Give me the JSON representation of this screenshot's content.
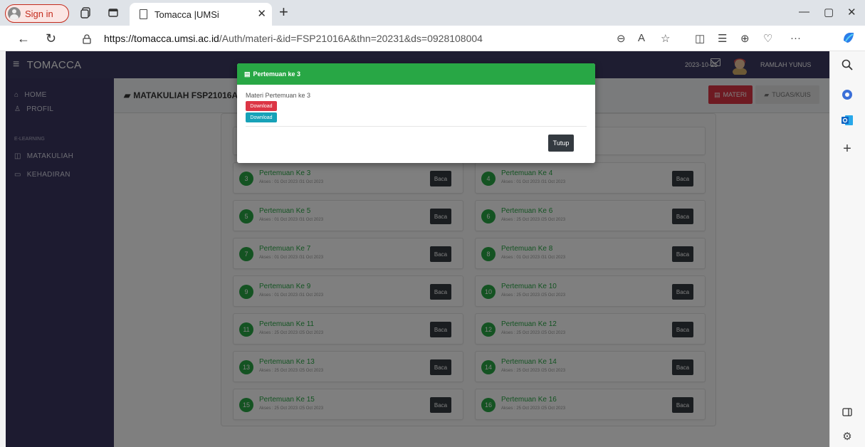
{
  "browser": {
    "signin_label": "Sign in",
    "tab_title": "Tomacca |UMSi",
    "url_host": "https://tomacca.umsi.ac.id",
    "url_path": "/Auth/materi-&id=FSP21016A&thn=20231&ds=0928108004"
  },
  "app": {
    "brand": "TOMACCA",
    "date": "2023-10-25",
    "user_name": "RAMLAH YUNUS"
  },
  "sidebar": {
    "items_top": [
      {
        "label": "HOME"
      },
      {
        "label": "PROFIL"
      }
    ],
    "section_label": "E-LEARNING",
    "items_bottom": [
      {
        "label": "MATAKULIAH"
      },
      {
        "label": "KEHADIRAN"
      }
    ]
  },
  "content": {
    "course_title": "MATAKULIAH FSP21016A-",
    "btn_materi": "MATERI",
    "btn_tugas": "TUGAS/KUIS",
    "baca_label": "Baca",
    "meetings": [
      {
        "num": "3",
        "title": "Pertemuan Ke 3",
        "access": "Akses : 01 Oct 2023 /31 Oct 2023"
      },
      {
        "num": "4",
        "title": "Pertemuan Ke 4",
        "access": "Akses : 01 Oct 2023 /31 Oct 2023"
      },
      {
        "num": "5",
        "title": "Pertemuan Ke 5",
        "access": "Akses : 01 Oct 2023 /31 Oct 2023"
      },
      {
        "num": "6",
        "title": "Pertemuan Ke 6",
        "access": "Akses : 25 Oct 2023 /25 Oct 2023"
      },
      {
        "num": "7",
        "title": "Pertemuan Ke 7",
        "access": "Akses : 01 Oct 2023 /31 Oct 2023"
      },
      {
        "num": "8",
        "title": "Pertemuan Ke 8",
        "access": "Akses : 01 Oct 2023 /31 Oct 2023"
      },
      {
        "num": "9",
        "title": "Pertemuan Ke 9",
        "access": "Akses : 01 Oct 2023 /31 Oct 2023"
      },
      {
        "num": "10",
        "title": "Pertemuan Ke 10",
        "access": "Akses : 25 Oct 2023 /25 Oct 2023"
      },
      {
        "num": "11",
        "title": "Pertemuan Ke 11",
        "access": "Akses : 25 Oct 2023 /25 Oct 2023"
      },
      {
        "num": "12",
        "title": "Pertemuan Ke 12",
        "access": "Akses : 25 Oct 2023 /25 Oct 2023"
      },
      {
        "num": "13",
        "title": "Pertemuan Ke 13",
        "access": "Akses : 25 Oct 2023 /25 Oct 2023"
      },
      {
        "num": "14",
        "title": "Pertemuan Ke 14",
        "access": "Akses : 25 Oct 2023 /25 Oct 2023"
      },
      {
        "num": "15",
        "title": "Pertemuan Ke 15",
        "access": "Akses : 25 Oct 2023 /25 Oct 2023"
      },
      {
        "num": "16",
        "title": "Pertemuan Ke 16",
        "access": "Akses : 25 Oct 2023 /25 Oct 2023"
      }
    ]
  },
  "modal": {
    "title": "Pertemuan ke 3",
    "text": "Materi Pertemuan ke 3",
    "download_1": "Download",
    "download_2": "Download",
    "close_label": "Tutup"
  },
  "colors": {
    "nav": "#3d3a63",
    "sidebar": "#3a3760",
    "success": "#28a745",
    "danger": "#dc3545",
    "info": "#17a2b8",
    "dark": "#343a40"
  }
}
